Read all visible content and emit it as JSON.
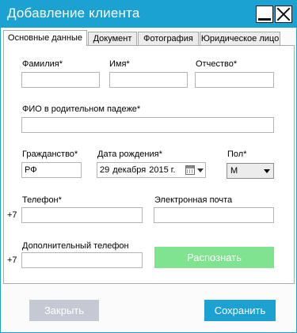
{
  "window": {
    "title": "Добавление клиента",
    "accent_color": "#1ba1d2",
    "minimize_icon": "minimize-icon",
    "close_icon": "close-icon"
  },
  "tabs": [
    {
      "label": "Основные данные",
      "active": true
    },
    {
      "label": "Документ",
      "active": false
    },
    {
      "label": "Фотография",
      "active": false
    },
    {
      "label": "Юридическое лицо",
      "active": false
    }
  ],
  "form": {
    "last_name": {
      "label": "Фамилия*",
      "value": ""
    },
    "first_name": {
      "label": "Имя*",
      "value": ""
    },
    "patronymic": {
      "label": "Отчество*",
      "value": ""
    },
    "genitive_name": {
      "label": "ФИО в родительном падеже*",
      "value": ""
    },
    "citizenship": {
      "label": "Гражданство*",
      "value": "РФ"
    },
    "birth_date": {
      "label": "Дата рождения*",
      "day": "29",
      "month": "декабря",
      "year": "2015 г."
    },
    "gender": {
      "label": "Пол*",
      "value": "М"
    },
    "phone": {
      "label": "Телефон*",
      "prefix": "+7",
      "value": ""
    },
    "email": {
      "label": "Электронная почта",
      "value": ""
    },
    "extra_phone": {
      "label": "Дополнительный телефон",
      "prefix": "+7",
      "value": ""
    }
  },
  "buttons": {
    "recognize": "Распознать",
    "recognize_color": "#80e38f",
    "close": "Закрыть",
    "close_color": "#c5c9d3",
    "save": "Сохранить",
    "save_color": "#1ba1d2"
  }
}
